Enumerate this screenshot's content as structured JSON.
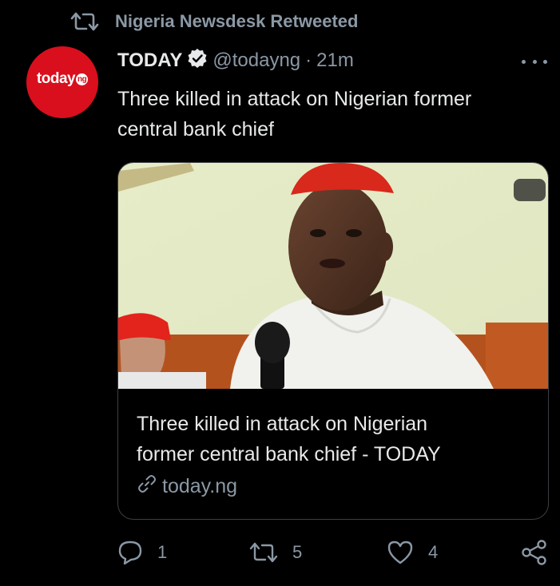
{
  "retweet_header": {
    "icon": "retweet-icon",
    "text": "Nigeria Newsdesk Retweeted"
  },
  "tweet": {
    "avatar": {
      "logo_text": "today",
      "logo_badge": "ng",
      "color": "#d90f1d"
    },
    "author_name": "TODAY",
    "verified_icon": "verified-badge-icon",
    "handle": "@todayng",
    "separator": "·",
    "time": "21m",
    "more_icon": "more-options-icon",
    "text_line1": "Three killed in attack on Nigerian former",
    "text_line2": "central bank chief"
  },
  "link_card": {
    "image": "photo-of-man-in-red-cap-speaking-into-microphone",
    "title_line1": "Three killed in attack on Nigerian",
    "title_line2": "former central bank chief - TODAY",
    "link_icon": "link-icon",
    "domain": "today.ng"
  },
  "actions": {
    "reply": {
      "icon": "reply-icon",
      "count": "1"
    },
    "retweet": {
      "icon": "retweet-icon",
      "count": "5"
    },
    "like": {
      "icon": "heart-icon",
      "count": "4"
    },
    "share": {
      "icon": "share-icon"
    }
  },
  "colors": {
    "background": "#000000",
    "text_primary": "#e7e9ea",
    "text_secondary": "#8b98a5",
    "border": "#3a3f44"
  }
}
